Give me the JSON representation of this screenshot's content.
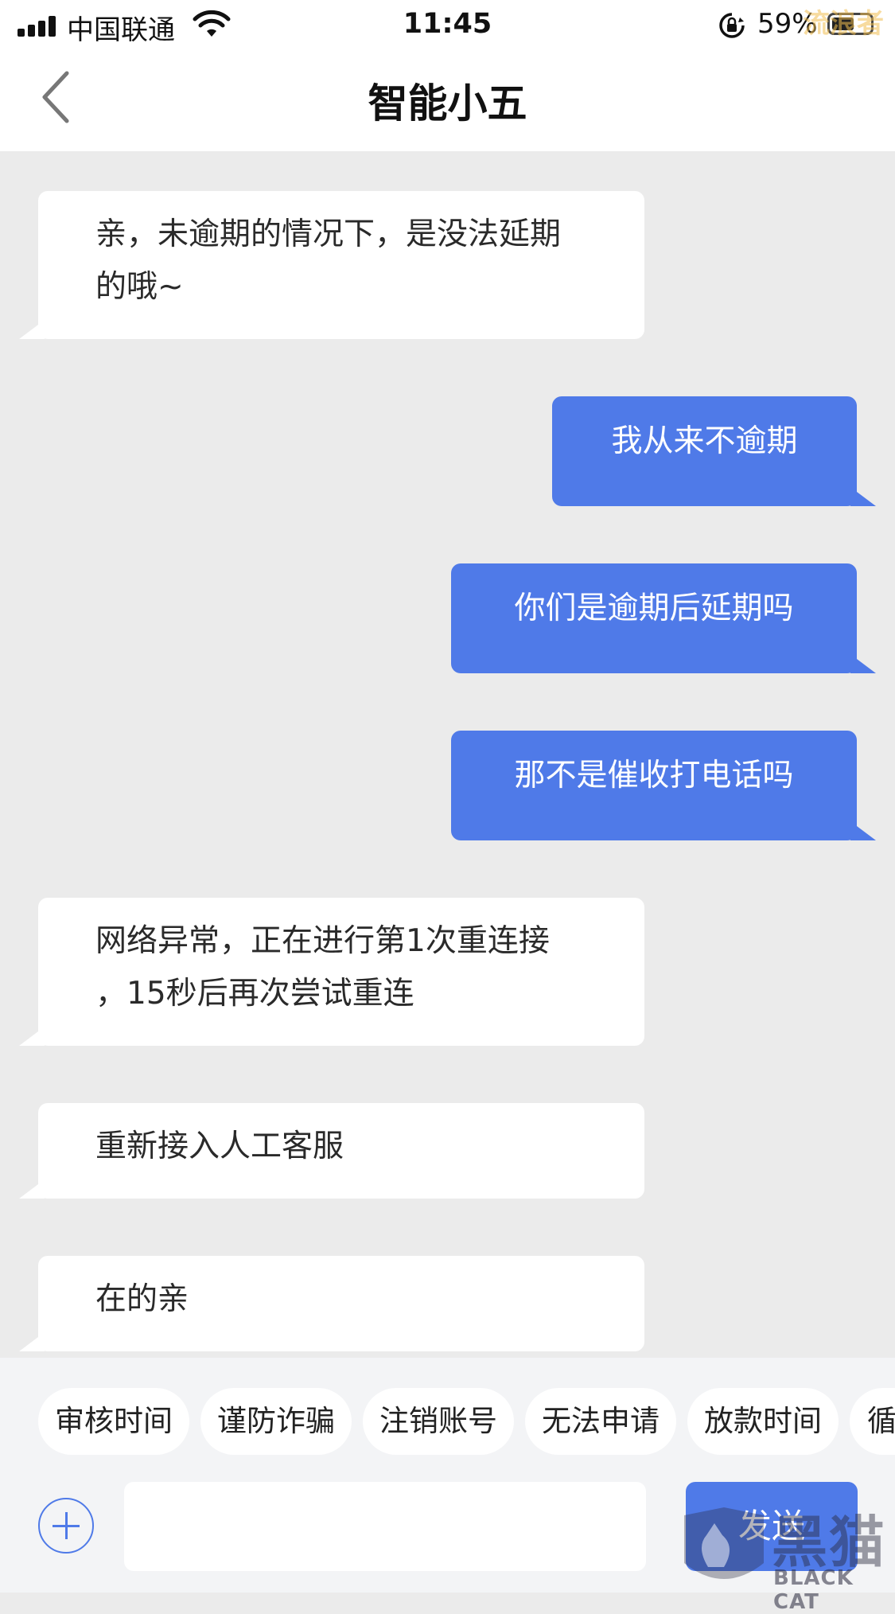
{
  "status_bar": {
    "carrier": "中国联通",
    "time": "11:45",
    "battery": "59%",
    "battery_level": 0.59,
    "watermark": "流浪者"
  },
  "nav": {
    "title": "智能小五",
    "back_icon": "chevron-left-icon"
  },
  "messages": [
    {
      "sender": "bot",
      "lines": [
        "亲，未逾期的情况下，是没法延期",
        "的哦~"
      ]
    },
    {
      "sender": "user",
      "lines": [
        "我从来不逾期"
      ]
    },
    {
      "sender": "user",
      "lines": [
        "你们是逾期后延期吗"
      ]
    },
    {
      "sender": "user",
      "lines": [
        "那不是催收打电话吗"
      ]
    },
    {
      "sender": "bot",
      "lines": [
        "网络异常，正在进行第1次重连接",
        "，15秒后再次尝试重连"
      ]
    },
    {
      "sender": "bot",
      "lines": [
        "重新接入人工客服"
      ]
    },
    {
      "sender": "bot",
      "lines": [
        "在的亲"
      ]
    }
  ],
  "quick_replies": [
    "审核时间",
    "谨防诈骗",
    "注销账号",
    "无法申请",
    "放款时间",
    "循"
  ],
  "composer": {
    "plus_icon": "plus-circle-icon",
    "input_value": "",
    "input_placeholder": "",
    "send_label": "发送"
  },
  "watermark": {
    "cn": "黑猫",
    "en": "BLACK CAT"
  },
  "colors": {
    "accent": "#4f7ae8",
    "chat_bg": "#ebebeb",
    "bubble_in": "#ffffff"
  }
}
